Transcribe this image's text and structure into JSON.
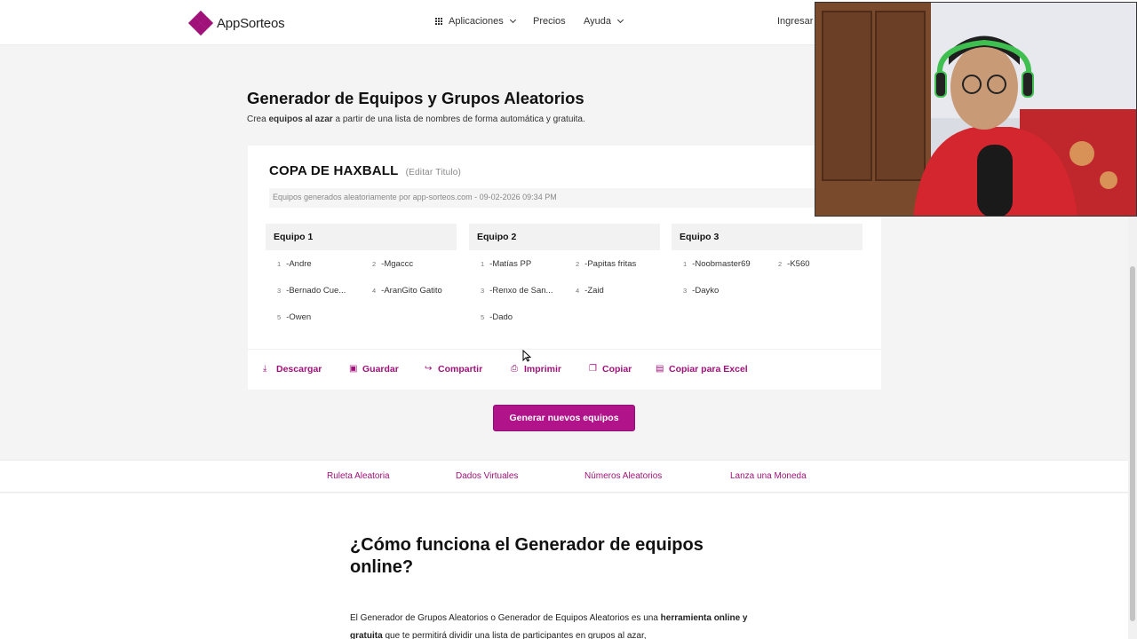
{
  "nav": {
    "brand": "AppSorteos",
    "apps_label": "Aplicaciones",
    "pricing_label": "Precios",
    "help_label": "Ayuda",
    "login_label": "Ingresar"
  },
  "header": {
    "title": "Generador de Equipos y Grupos Aleatorios",
    "subtitle_pre": "Crea ",
    "subtitle_bold": "equipos al azar",
    "subtitle_post": " a partir de una lista de nombres de forma automática y gratuita."
  },
  "card": {
    "title": "COPA DE HAXBALL",
    "edit_label": "(Editar Titulo)",
    "generated_note": "Equipos generados aleatoriamente por app-sorteos.com - 09-02-2026 09:34 PM"
  },
  "teams": [
    {
      "name": "Equipo 1",
      "members": [
        {
          "n": "1",
          "name": "-Andre"
        },
        {
          "n": "2",
          "name": "-Mgaccc"
        },
        {
          "n": "3",
          "name": "-Bernado Cue..."
        },
        {
          "n": "4",
          "name": "-AranGito Gatito"
        },
        {
          "n": "5",
          "name": "-Owen"
        }
      ]
    },
    {
      "name": "Equipo 2",
      "members": [
        {
          "n": "1",
          "name": "-Matías PP"
        },
        {
          "n": "2",
          "name": "-Papitas fritas"
        },
        {
          "n": "3",
          "name": "-Renxo de San..."
        },
        {
          "n": "4",
          "name": "-Zaid"
        },
        {
          "n": "5",
          "name": "-Dado"
        }
      ]
    },
    {
      "name": "Equipo 3",
      "members": [
        {
          "n": "1",
          "name": "-Noobmaster69"
        },
        {
          "n": "2",
          "name": "-K560"
        },
        {
          "n": "3",
          "name": "-Dayko"
        }
      ]
    }
  ],
  "actions": {
    "download": "Descargar",
    "save": "Guardar",
    "share": "Compartir",
    "print": "Imprimir",
    "copy": "Copiar",
    "copy_excel": "Copiar para Excel"
  },
  "generate_button": "Generar nuevos equipos",
  "links": [
    "Ruleta Aleatoria",
    "Dados Virtuales",
    "Números Aleatorios",
    "Lanza una Moneda"
  ],
  "article": {
    "title": "¿Cómo funciona el Generador de equipos online?",
    "p_pre": "El Generador de Grupos Aleatorios o Generador de Equipos Aleatorios es una ",
    "p_bold": "herramienta online y gratuita",
    "p_post": " que te permitirá dividir una lista de participantes en grupos al azar,"
  },
  "colors": {
    "accent": "#b0138a",
    "accent_text": "#a0117a"
  }
}
